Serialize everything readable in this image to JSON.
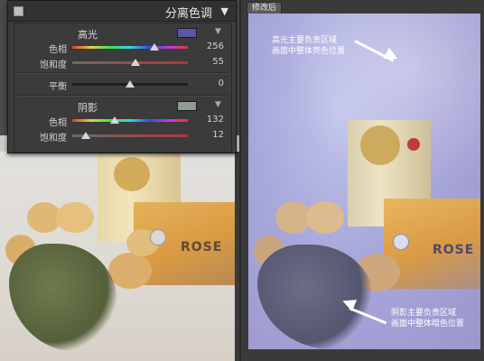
{
  "panel": {
    "title": "分离色调",
    "highlights": {
      "label": "高光",
      "swatch_color": "#5c55a8",
      "hue": {
        "label": "色相",
        "value": "256",
        "level": 0.71
      },
      "saturation": {
        "label": "饱和度",
        "value": "55",
        "level": 0.55
      }
    },
    "balance": {
      "label": "平衡",
      "value": "0",
      "level": 0.5
    },
    "shadows": {
      "label": "阴影",
      "swatch_color": "#8e9d90",
      "hue": {
        "label": "色相",
        "value": "132",
        "level": 0.37
      },
      "saturation": {
        "label": "饱和度",
        "value": "12",
        "level": 0.12
      }
    }
  },
  "after_view": {
    "tab_label": "修改后",
    "annotation_highlight": {
      "line1": "高光主要负责区域",
      "line2": "画面中整体亮色位置"
    },
    "annotation_shadow": {
      "line1": "阴影主要负责区域",
      "line2": "画面中整体暗色位置"
    }
  },
  "photo_text": {
    "label": "ROSE"
  }
}
